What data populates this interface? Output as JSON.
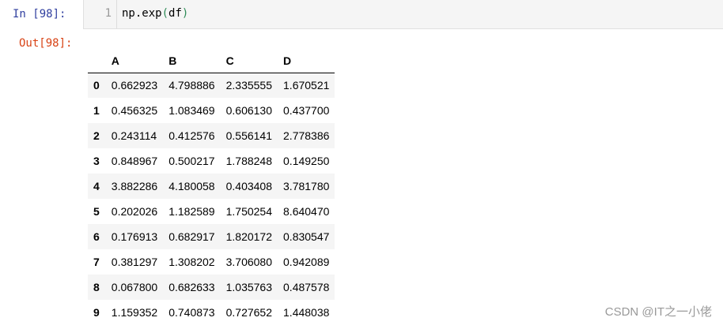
{
  "input_cell": {
    "prompt": "In  [98]:",
    "line_number": "1",
    "code_prefix": "np.exp",
    "code_open": "(",
    "code_arg": "df",
    "code_close": ")"
  },
  "output_cell": {
    "prompt": "Out[98]:",
    "columns": [
      "A",
      "B",
      "C",
      "D"
    ],
    "rows": [
      {
        "index": "0",
        "values": [
          "0.662923",
          "4.798886",
          "2.335555",
          "1.670521"
        ]
      },
      {
        "index": "1",
        "values": [
          "0.456325",
          "1.083469",
          "0.606130",
          "0.437700"
        ]
      },
      {
        "index": "2",
        "values": [
          "0.243114",
          "0.412576",
          "0.556141",
          "2.778386"
        ]
      },
      {
        "index": "3",
        "values": [
          "0.848967",
          "0.500217",
          "1.788248",
          "0.149250"
        ]
      },
      {
        "index": "4",
        "values": [
          "3.882286",
          "4.180058",
          "0.403408",
          "3.781780"
        ]
      },
      {
        "index": "5",
        "values": [
          "0.202026",
          "1.182589",
          "1.750254",
          "8.640470"
        ]
      },
      {
        "index": "6",
        "values": [
          "0.176913",
          "0.682917",
          "1.820172",
          "0.830547"
        ]
      },
      {
        "index": "7",
        "values": [
          "0.381297",
          "1.308202",
          "3.706080",
          "0.942089"
        ]
      },
      {
        "index": "8",
        "values": [
          "0.067800",
          "0.682633",
          "1.035763",
          "0.487578"
        ]
      },
      {
        "index": "9",
        "values": [
          "1.159352",
          "0.740873",
          "0.727652",
          "1.448038"
        ]
      }
    ]
  },
  "watermark": "CSDN @IT之一小佬",
  "colors": {
    "in_prompt": "#303F9F",
    "out_prompt": "#D84315",
    "input_bg": "#f5f5f5",
    "striped_row": "#f5f5f5"
  }
}
